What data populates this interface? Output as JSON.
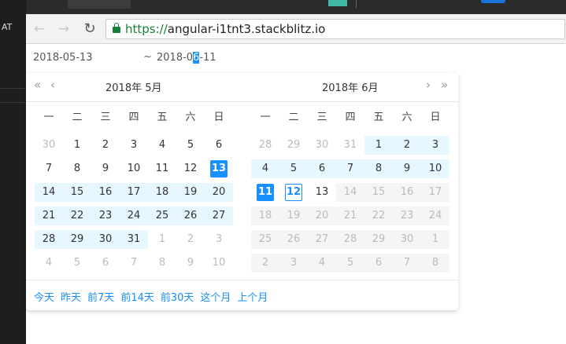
{
  "ide": {
    "left_label": "AT"
  },
  "browser": {
    "back_icon": "←",
    "forward_icon": "→",
    "reload_icon": "↻",
    "url_scheme": "https://",
    "url_host": "angular-i1tnt3.stackblitz.io"
  },
  "range_input": {
    "start": "2018-05-13",
    "separator": "~",
    "end_before": "2018-0",
    "end_selected": "6",
    "end_after": "-11"
  },
  "picker": {
    "prev_year": "«",
    "prev_month": "‹",
    "next_month": "›",
    "next_year": "»",
    "left_title": "2018年 5月",
    "right_title": "2018年 6月",
    "weekdays": [
      "一",
      "二",
      "三",
      "四",
      "五",
      "六",
      "日"
    ],
    "left_weeks": [
      [
        {
          "d": "30",
          "s": "other"
        },
        {
          "d": "1"
        },
        {
          "d": "2"
        },
        {
          "d": "3"
        },
        {
          "d": "4"
        },
        {
          "d": "5"
        },
        {
          "d": "6"
        }
      ],
      [
        {
          "d": "7"
        },
        {
          "d": "8"
        },
        {
          "d": "9"
        },
        {
          "d": "10"
        },
        {
          "d": "11"
        },
        {
          "d": "12"
        },
        {
          "d": "13",
          "s": "selected"
        }
      ],
      [
        {
          "d": "14",
          "s": "inrange"
        },
        {
          "d": "15",
          "s": "inrange"
        },
        {
          "d": "16",
          "s": "inrange"
        },
        {
          "d": "17",
          "s": "inrange"
        },
        {
          "d": "18",
          "s": "inrange"
        },
        {
          "d": "19",
          "s": "inrange"
        },
        {
          "d": "20",
          "s": "inrange"
        }
      ],
      [
        {
          "d": "21",
          "s": "inrange"
        },
        {
          "d": "22",
          "s": "inrange"
        },
        {
          "d": "23",
          "s": "inrange"
        },
        {
          "d": "24",
          "s": "inrange"
        },
        {
          "d": "25",
          "s": "inrange"
        },
        {
          "d": "26",
          "s": "inrange"
        },
        {
          "d": "27",
          "s": "inrange"
        }
      ],
      [
        {
          "d": "28",
          "s": "inrange"
        },
        {
          "d": "29",
          "s": "inrange"
        },
        {
          "d": "30",
          "s": "inrange"
        },
        {
          "d": "31",
          "s": "inrange"
        },
        {
          "d": "1",
          "s": "other"
        },
        {
          "d": "2",
          "s": "other"
        },
        {
          "d": "3",
          "s": "other"
        }
      ],
      [
        {
          "d": "4",
          "s": "other"
        },
        {
          "d": "5",
          "s": "other"
        },
        {
          "d": "6",
          "s": "other"
        },
        {
          "d": "7",
          "s": "other"
        },
        {
          "d": "8",
          "s": "other"
        },
        {
          "d": "9",
          "s": "other"
        },
        {
          "d": "10",
          "s": "other"
        }
      ]
    ],
    "right_weeks": [
      [
        {
          "d": "28",
          "s": "other"
        },
        {
          "d": "29",
          "s": "other"
        },
        {
          "d": "30",
          "s": "other"
        },
        {
          "d": "31",
          "s": "other"
        },
        {
          "d": "1",
          "s": "inrange"
        },
        {
          "d": "2",
          "s": "inrange"
        },
        {
          "d": "3",
          "s": "inrange"
        }
      ],
      [
        {
          "d": "4",
          "s": "inrange"
        },
        {
          "d": "5",
          "s": "inrange"
        },
        {
          "d": "6",
          "s": "inrange"
        },
        {
          "d": "7",
          "s": "inrange"
        },
        {
          "d": "8",
          "s": "inrange"
        },
        {
          "d": "9",
          "s": "inrange"
        },
        {
          "d": "10",
          "s": "inrange"
        }
      ],
      [
        {
          "d": "11",
          "s": "selected"
        },
        {
          "d": "12",
          "s": "today"
        },
        {
          "d": "13"
        },
        {
          "d": "14",
          "s": "disabled"
        },
        {
          "d": "15",
          "s": "disabled"
        },
        {
          "d": "16",
          "s": "disabled"
        },
        {
          "d": "17",
          "s": "disabled"
        }
      ],
      [
        {
          "d": "18",
          "s": "disabled"
        },
        {
          "d": "19",
          "s": "disabled"
        },
        {
          "d": "20",
          "s": "disabled"
        },
        {
          "d": "21",
          "s": "disabled"
        },
        {
          "d": "22",
          "s": "disabled"
        },
        {
          "d": "23",
          "s": "disabled"
        },
        {
          "d": "24",
          "s": "disabled"
        }
      ],
      [
        {
          "d": "25",
          "s": "disabled"
        },
        {
          "d": "26",
          "s": "disabled"
        },
        {
          "d": "27",
          "s": "disabled"
        },
        {
          "d": "28",
          "s": "disabled"
        },
        {
          "d": "29",
          "s": "disabled"
        },
        {
          "d": "30",
          "s": "disabled"
        },
        {
          "d": "1",
          "s": "disabled"
        }
      ],
      [
        {
          "d": "2",
          "s": "disabled"
        },
        {
          "d": "3",
          "s": "disabled"
        },
        {
          "d": "4",
          "s": "disabled"
        },
        {
          "d": "5",
          "s": "disabled"
        },
        {
          "d": "6",
          "s": "disabled"
        },
        {
          "d": "7",
          "s": "disabled"
        },
        {
          "d": "8",
          "s": "disabled"
        }
      ]
    ],
    "presets": [
      "今天",
      "昨天",
      "前7天",
      "前14天",
      "前30天",
      "这个月",
      "上个月"
    ]
  },
  "colors": {
    "accent": "#1890ff",
    "range_bg": "#e6f7ff",
    "disabled_bg": "#f5f5f5",
    "url_green": "#188038"
  }
}
